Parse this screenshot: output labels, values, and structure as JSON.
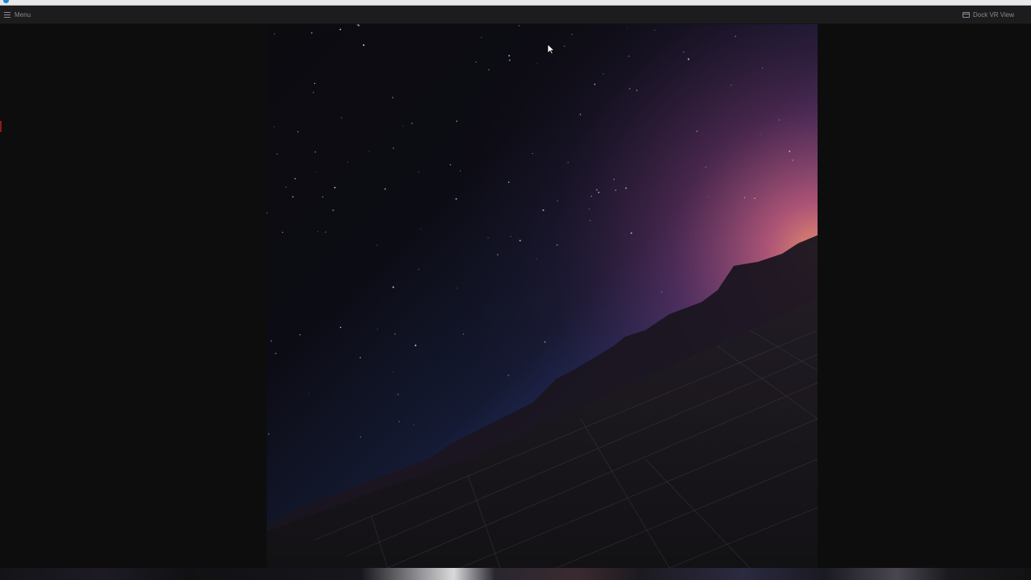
{
  "window": {
    "title": ""
  },
  "toolbar": {
    "menu_label": "Menu",
    "menu_icon": "hamburger-icon",
    "dock_label": "Dock VR View",
    "dock_icon": "dock-window-icon"
  },
  "vr_view": {
    "scene": "night-sky-horizon-grid",
    "colors": {
      "sky_top": "#0b0b10",
      "horizon_blue": "#3f5aa8",
      "horizon_magenta": "#a24a7c",
      "glow_orange": "#e0876a",
      "ground": "#17151a",
      "grid_line": "#3a3840"
    }
  },
  "colors": {
    "background": "#0d0d0e",
    "toolbar": "#1c1c1e",
    "toolbar_text": "#8a8a90",
    "window_strip": "#e8e8ea"
  }
}
